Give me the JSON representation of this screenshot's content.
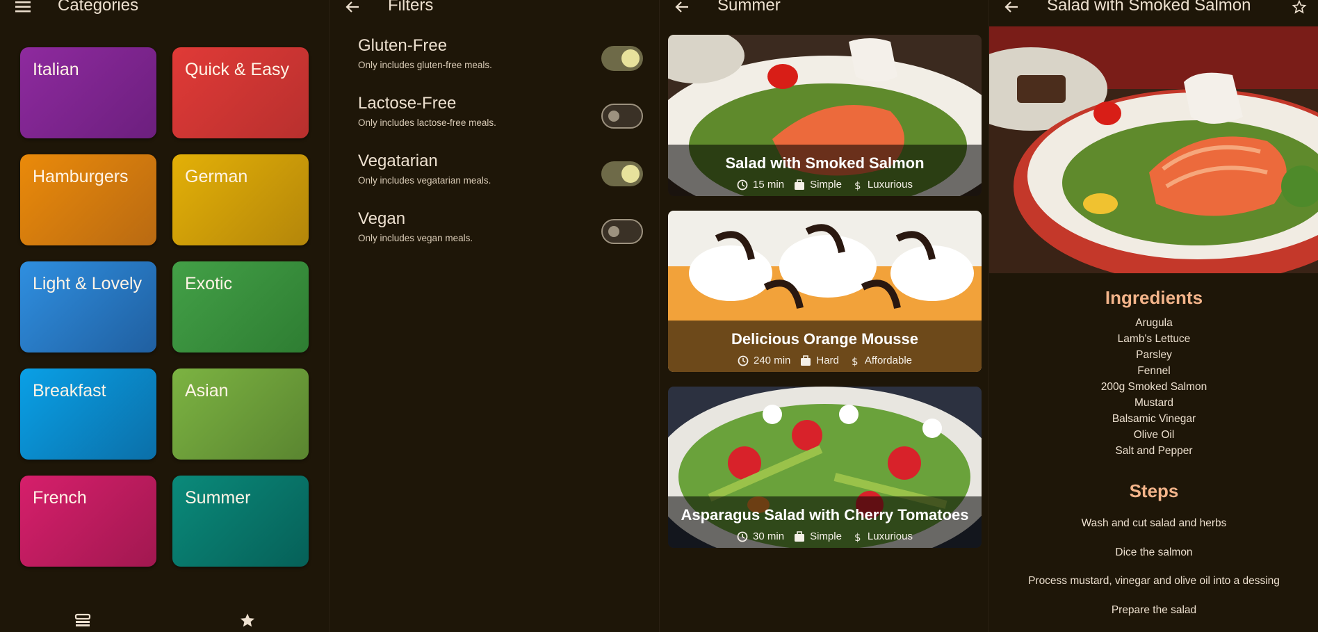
{
  "categories": {
    "title": "Categories",
    "menu_icon": "menu-icon",
    "items": [
      {
        "label": "Italian",
        "c1": "#8e2a9e",
        "c2": "#6c1f7e"
      },
      {
        "label": "Quick & Easy",
        "c1": "#e03a37",
        "c2": "#b8302e"
      },
      {
        "label": "Hamburgers",
        "c1": "#ea8a0a",
        "c2": "#b96a12"
      },
      {
        "label": "German",
        "c1": "#e3b007",
        "c2": "#b4860a"
      },
      {
        "label": "Light & Lovely",
        "c1": "#2f8fe0",
        "c2": "#205fa0"
      },
      {
        "label": "Exotic",
        "c1": "#43a047",
        "c2": "#2e7d32"
      },
      {
        "label": "Breakfast",
        "c1": "#0aa0e6",
        "c2": "#0b6fa8"
      },
      {
        "label": "Asian",
        "c1": "#7cb342",
        "c2": "#5a8530"
      },
      {
        "label": "French",
        "c1": "#d61f6b",
        "c2": "#a11850"
      },
      {
        "label": "Summer",
        "c1": "#0a8a7a",
        "c2": "#066058"
      }
    ],
    "nav": [
      {
        "icon": "meals-icon"
      },
      {
        "icon": "star-icon"
      }
    ]
  },
  "filters": {
    "title": "Filters",
    "back_icon": "back-arrow-icon",
    "items": [
      {
        "title": "Gluten-Free",
        "subtitle": "Only includes gluten-free meals.",
        "on": true
      },
      {
        "title": "Lactose-Free",
        "subtitle": "Only includes lactose-free meals.",
        "on": false
      },
      {
        "title": "Vegatarian",
        "subtitle": "Only includes vegatarian meals.",
        "on": true
      },
      {
        "title": "Vegan",
        "subtitle": "Only includes vegan meals.",
        "on": false
      }
    ]
  },
  "meals": {
    "title": "Summer",
    "back_icon": "back-arrow-icon",
    "items": [
      {
        "title": "Salad with Smoked Salmon",
        "duration": "15 min",
        "complexity": "Simple",
        "affordability": "Luxurious"
      },
      {
        "title": "Delicious Orange Mousse",
        "duration": "240 min",
        "complexity": "Hard",
        "affordability": "Affordable"
      },
      {
        "title": "Asparagus Salad with Cherry Tomatoes",
        "duration": "30 min",
        "complexity": "Simple",
        "affordability": "Luxurious"
      }
    ]
  },
  "detail": {
    "title": "Salad with Smoked Salmon",
    "back_icon": "back-arrow-icon",
    "favorite_icon": "star-outline-icon",
    "ingredients_heading": "Ingredients",
    "ingredients": [
      "Arugula",
      "Lamb's Lettuce",
      "Parsley",
      "Fennel",
      "200g Smoked Salmon",
      "Mustard",
      "Balsamic Vinegar",
      "Olive Oil",
      "Salt and Pepper"
    ],
    "steps_heading": "Steps",
    "steps": [
      "Wash and cut salad and herbs",
      "Dice the salmon",
      "Process mustard, vinegar and olive oil into a dessing",
      "Prepare the salad"
    ]
  }
}
